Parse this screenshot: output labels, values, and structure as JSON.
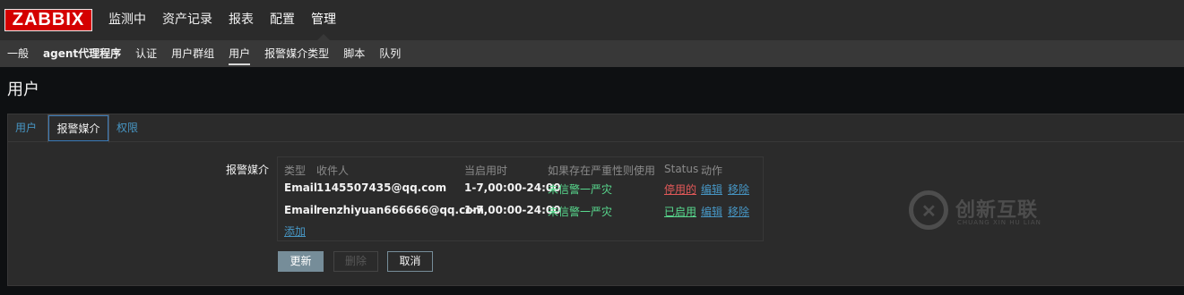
{
  "brand": {
    "logo": "ZABBIX"
  },
  "main_menu": [
    "监测中",
    "资产记录",
    "报表",
    "配置",
    "管理"
  ],
  "sub_menu": [
    "一般",
    "agent代理程序",
    "认证",
    "用户群组",
    "用户",
    "报警媒介类型",
    "脚本",
    "队列"
  ],
  "page_title": "用户",
  "tabs": [
    "用户",
    "报警媒介",
    "权限"
  ],
  "form": {
    "label": "报警媒介",
    "headers": [
      "类型",
      "收件人",
      "当启用时",
      "如果存在严重性则使用",
      "Status",
      "动作"
    ],
    "rows": [
      {
        "type": "Email",
        "recipient": "1145507435@qq.com",
        "when_active": "1-7,00:00-24:00",
        "severity": "未信警一严灾",
        "status": "停用的",
        "edit": "编辑",
        "remove": "移除"
      },
      {
        "type": "Email",
        "recipient": "renzhiyuan666666@qq.com",
        "when_active": "1-7,00:00-24:00",
        "severity": "未信警一严灾",
        "status": "已启用",
        "edit": "编辑",
        "remove": "移除"
      }
    ],
    "add_link": "添加"
  },
  "buttons": {
    "update": "更新",
    "delete": "删除",
    "cancel": "取消"
  },
  "watermark": {
    "cn": "创新互联",
    "en": "CHUANG XIN HU LIAN"
  },
  "colors": {
    "accent": "#d40000",
    "link": "#4796c4",
    "enabled": "#59db8f",
    "disabled": "#e45959",
    "primary_button": "#768d99"
  }
}
